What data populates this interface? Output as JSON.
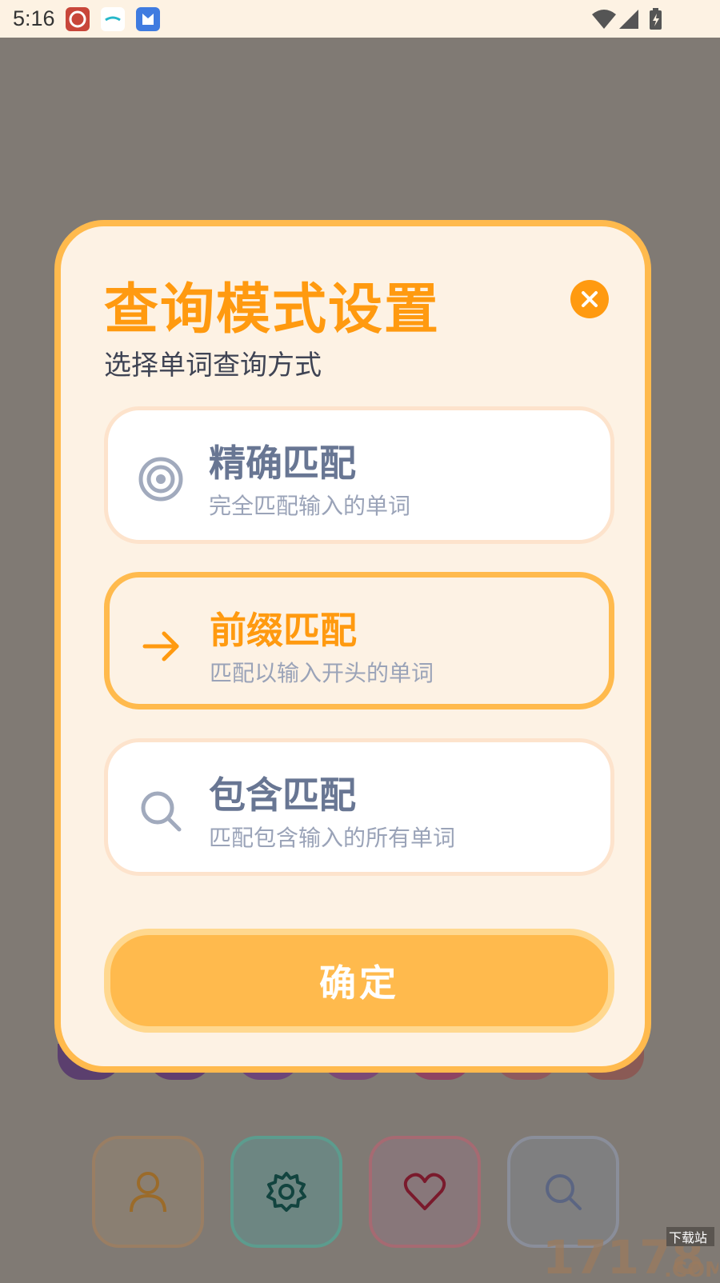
{
  "status_bar": {
    "time": "5:16",
    "icons": [
      "app-notification-icon",
      "app-notification-icon",
      "app-notification-icon",
      "wifi-icon",
      "cellular-signal-icon",
      "battery-charging-icon"
    ]
  },
  "dialog": {
    "title": "查询模式设置",
    "subtitle": "选择单词查询方式",
    "close_icon": "close-icon",
    "options": [
      {
        "icon": "target-icon",
        "title": "精确匹配",
        "desc": "完全匹配输入的单词",
        "selected": false
      },
      {
        "icon": "arrow-right-icon",
        "title": "前缀匹配",
        "desc": "匹配以输入开头的单词",
        "selected": true
      },
      {
        "icon": "search-icon",
        "title": "包含匹配",
        "desc": "匹配包含输入的所有单词",
        "selected": false
      }
    ],
    "confirm_label": "确定"
  },
  "bottom_nav": [
    {
      "icon": "user-icon"
    },
    {
      "icon": "gear-icon"
    },
    {
      "icon": "heart-icon"
    },
    {
      "icon": "search-icon"
    }
  ],
  "watermark": {
    "number": "17178",
    "label": "下载站",
    "suffix": ".COM"
  },
  "colors": {
    "accent": "#ff9a10",
    "border_orange": "#ffba4d",
    "dialog_bg": "#fdf2e4",
    "overlay": "#807a74"
  }
}
